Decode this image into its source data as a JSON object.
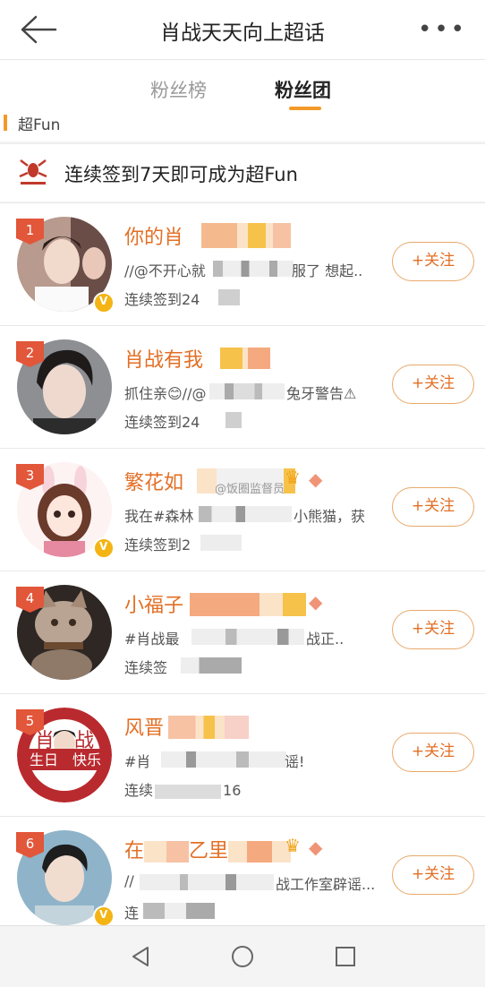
{
  "header": {
    "title": "肖战天天向上超话"
  },
  "tabs": [
    {
      "label": "粉丝榜"
    },
    {
      "label": "粉丝团"
    }
  ],
  "section_label": "超Fun",
  "notice": "连续签到7天即可成为超Fun",
  "follow_label": "+关注",
  "rows": [
    {
      "rank": "1",
      "name": "你的肖",
      "sub": "//@不开心就",
      "sub2": "服了 想起..",
      "checkin": "连续签到24"
    },
    {
      "rank": "2",
      "name": "肖战有我",
      "sub": "抓住亲😊//@",
      "sub2": "兔牙警告⚠",
      "checkin": "连续签到24"
    },
    {
      "rank": "3",
      "name": "繁花如",
      "sub": "我在#森林",
      "sub2": "小熊猫，获",
      "checkin": "连续签到2"
    },
    {
      "rank": "4",
      "name": "小福子",
      "sub": "#肖战最",
      "sub2": "战正..",
      "checkin": "连续签"
    },
    {
      "rank": "5",
      "name": "风晋",
      "sub": "#肖",
      "sub2": "谣!",
      "checkin": "连续",
      "checkin2": "16"
    },
    {
      "rank": "6",
      "name": "在",
      "name2": "乙里",
      "sub": "//",
      "sub2": "战工作室辟谣...",
      "checkin": "连"
    }
  ],
  "watermark": "@饭圈监督员",
  "colors": {
    "accent": "#e36f25",
    "tab_underline": "#f29a28"
  }
}
